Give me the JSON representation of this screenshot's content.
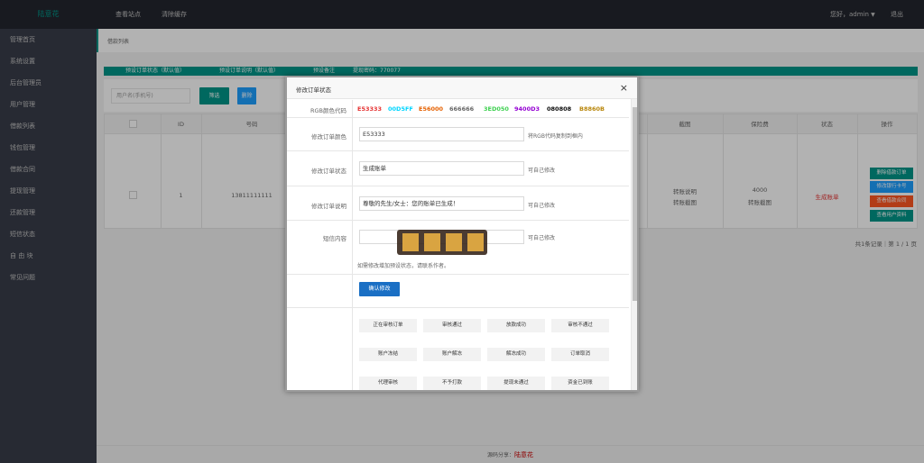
{
  "topbar": {
    "logo": "陆意花",
    "nav": [
      "查看站点",
      "清除缓存"
    ],
    "greeting": "您好，admin",
    "logout": "退出"
  },
  "sidebar": {
    "items": [
      "管理首页",
      "系统设置",
      "后台管理员",
      "用户管理",
      "借款列表",
      "钱包管理",
      "借款合同",
      "提现管理",
      "还款管理",
      "短信状态",
      "自 由 块",
      "常见问题"
    ]
  },
  "tab": {
    "label": "借款列表"
  },
  "statbar": {
    "items": [
      "预设订单状态（默认值）",
      "预设订单说明（默认值）",
      "预设备注",
      "提现密码：770077"
    ]
  },
  "filter": {
    "placeholder": "用户名(手机号)",
    "search_label": "筛选",
    "delete_label": "删除"
  },
  "table": {
    "headers": [
      "ID",
      "号码",
      "截图",
      "保险费",
      "状态",
      "操作"
    ],
    "row": {
      "id": "1",
      "phone": "13811111111",
      "screenshot_1": "转账说明",
      "screenshot_2": "转账截图",
      "insurance_1": "4000",
      "insurance_2": "转账截图",
      "status": "生成账单",
      "actions": [
        "删除借款订单",
        "修改银行卡号",
        "查看借款合同",
        "查看用户资料"
      ]
    }
  },
  "pager": "共1条记录｜第 1 / 1 页",
  "footer": {
    "prefix": "源码分享：",
    "brand": "陆意花"
  },
  "modal": {
    "title": "修改订单状态",
    "close": "×",
    "rgb_label": "RGB颜色代码",
    "rgb_codes": [
      {
        "code": "E53333",
        "color": "#e53333"
      },
      {
        "code": "00D5FF",
        "color": "#00d5ff"
      },
      {
        "code": "E56000",
        "color": "#e56000"
      },
      {
        "code": "666666",
        "color": "#666666"
      },
      {
        "code": "3ED050",
        "color": "#3ed050"
      },
      {
        "code": "9400D3",
        "color": "#9400d3"
      },
      {
        "code": "080808",
        "color": "#080808"
      },
      {
        "code": "B8860B",
        "color": "#b8860b"
      }
    ],
    "color_label": "修改订单颜色",
    "color_value": "E53333",
    "color_hint": "将RGB代码复制到框内",
    "status_label": "修改订单状态",
    "status_value": "生成账单",
    "status_hint": "可自己修改",
    "desc_label": "修改订单说明",
    "desc_value": "尊敬的先生/女士：您的账单已生成！",
    "desc_hint": "可自己修改",
    "sms_label": "短信内容",
    "sms_value": "",
    "sms_hint": "可自己修改",
    "note": "如需修改增加预设状态，请联系作者。",
    "confirm_label": "确认修改",
    "presets": [
      "正在审核订单",
      "审核通过",
      "放款成功",
      "审核不通过",
      "账户冻结",
      "账户解冻",
      "解冻成功",
      "订单取消",
      "代理审核",
      "不予打款",
      "提现未通过",
      "资金已到账"
    ]
  },
  "colors": {
    "primary": "#009688",
    "blue": "#1e9fff",
    "orange": "#ff5722",
    "danger": "#e53333",
    "topbar": "#23262e",
    "sidebar": "#393d49",
    "confirm": "#1a6fc4"
  }
}
